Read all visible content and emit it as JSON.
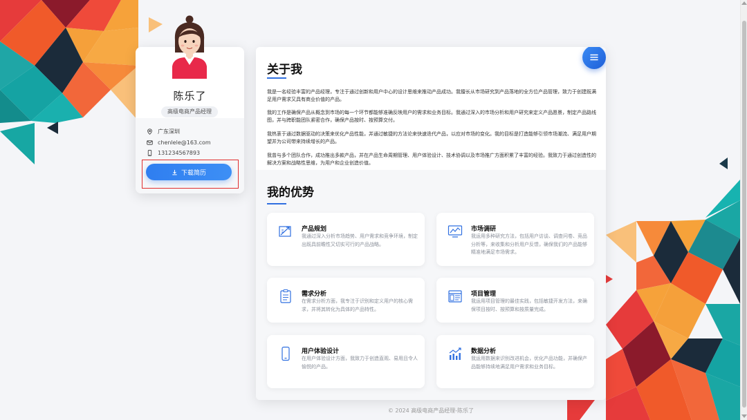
{
  "profile": {
    "name": "陈乐了",
    "title": "高级电商产品经理",
    "location": "广东深圳",
    "email": "chenlele@163.com",
    "phone": "131234567893",
    "download_label": "下载简历"
  },
  "about": {
    "heading": "关于我",
    "paragraphs": [
      "我是一名经验丰富的产品经理，专注于通过创新和用户中心的设计思维来推动产品成功。我擅长从市场研究到产品落地的全方位产品管理，致力于创建既满足用户需求又具有商业价值的产品。",
      "我的工作是确保产品从概念到市场的每一个环节都能够准确反映用户的需求和业务目标。我通过深入的市场分析和用户研究来定义产品愿景，制定产品路线图，并与跨职能团队紧密合作，确保产品按时、按预算交付。",
      "我热衷于通过数据驱动的决策来优化产品性能，并通过敏捷的方法论来快速迭代产品，以应对市场的变化。我的目标是打造能够引领市场潮流、满足用户期望并为公司带来持续增长的产品。",
      "我曾与多个团队合作，成功推出多款产品，并在产品生命周期管理、用户体验设计、技术协调以及市场推广方面积累了丰富的经验。我致力于通过创造性的解决方案和战略性思维，为用户和企业创造价值。"
    ]
  },
  "advantages": {
    "heading": "我的优势",
    "items": [
      {
        "title": "产品规划",
        "desc": "我通过深入分析市场趋势、用户需求和竞争环境，制定出既具前瞻性又切实可行的产品战略。",
        "icon": "planning-icon"
      },
      {
        "title": "市场调研",
        "desc": "我运用多种研究方法，包括用户访谈、调查问卷、竞品分析等，来收集和分析用户反馈，确保我们的产品能够精准地满足市场需求。",
        "icon": "market-chart-icon"
      },
      {
        "title": "需求分析",
        "desc": "在需求分析方面，我专注于识别和定义用户的核心需求，并将其转化为具体的产品特性。",
        "icon": "clipboard-icon"
      },
      {
        "title": "项目管理",
        "desc": "我运用项目管理的最佳实践，包括敏捷开发方法，来确保项目按时、按预算和按质量完成。",
        "icon": "project-window-icon"
      },
      {
        "title": "用户体验设计",
        "desc": "在用户体验设计方面，我致力于创造直观、易用且令人愉悦的产品。",
        "icon": "mobile-icon"
      },
      {
        "title": "数据分析",
        "desc": "我运用数据来识别改进机会，优化产品功能，并确保产品能够持续地满足用户需求和业务目标。",
        "icon": "bar-chart-icon"
      }
    ]
  },
  "footer": {
    "text": "© 2024 高级电商产品经理-陈乐了"
  },
  "colors": {
    "accent": "#2f6fe0",
    "highlight_border": "#e02c2c"
  }
}
